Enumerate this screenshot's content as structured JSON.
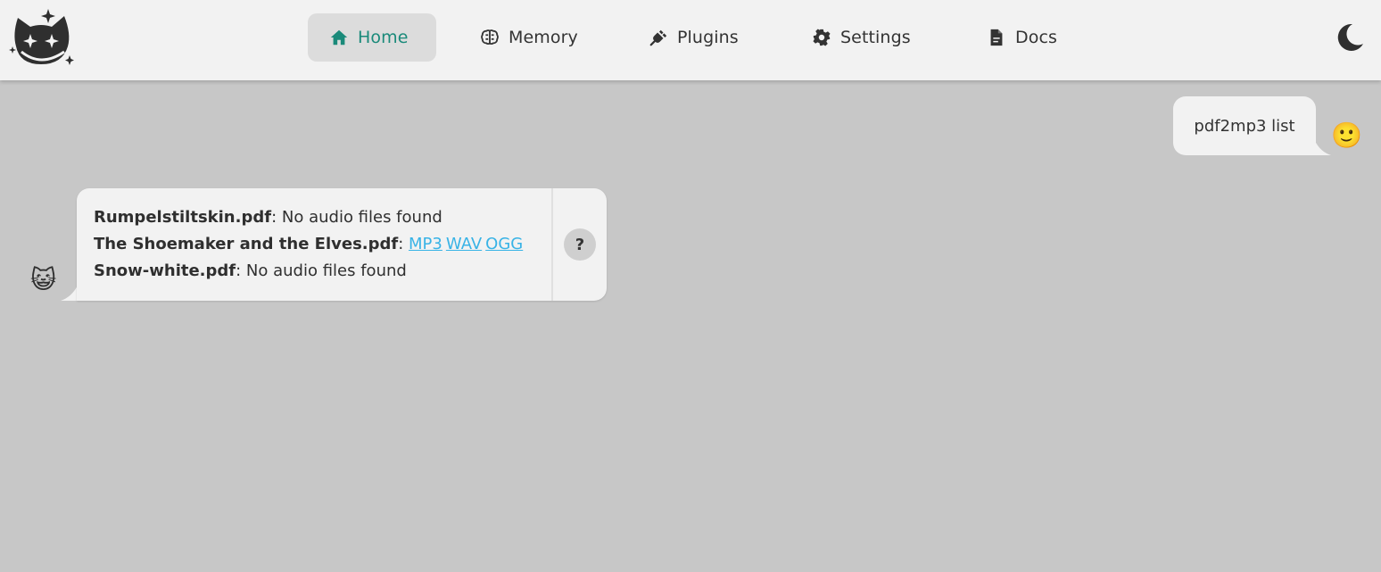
{
  "nav": {
    "items": [
      {
        "label": "Home",
        "icon": "home-icon",
        "active": true,
        "color": "#1a8a7a"
      },
      {
        "label": "Memory",
        "icon": "brain-icon",
        "active": false
      },
      {
        "label": "Plugins",
        "icon": "plug-icon",
        "active": false
      },
      {
        "label": "Settings",
        "icon": "gear-icon",
        "active": false
      },
      {
        "label": "Docs",
        "icon": "document-icon",
        "active": false
      }
    ],
    "theme_icon": "moon-icon",
    "logo_icon": "cat-logo-icon"
  },
  "chat": {
    "user_message": {
      "text": "pdf2mp3 list",
      "avatar": "🙂"
    },
    "bot_message": {
      "avatar": "😺",
      "lines": [
        {
          "filename": "Rumpelstiltskin.pdf",
          "sep": ": ",
          "text": "No audio files found",
          "links": []
        },
        {
          "filename": "The Shoemaker and the Elves.pdf",
          "sep": ": ",
          "text": "",
          "links": [
            "MP3",
            "WAV",
            "OGG"
          ]
        },
        {
          "filename": "Snow-white.pdf",
          "sep": ": ",
          "text": "No audio files found",
          "links": []
        }
      ],
      "why_label": "?"
    }
  },
  "colors": {
    "accent": "#1a8a7a",
    "link": "#38b3e6",
    "background": "#c7c7c7",
    "surface": "#f2f2f2"
  }
}
